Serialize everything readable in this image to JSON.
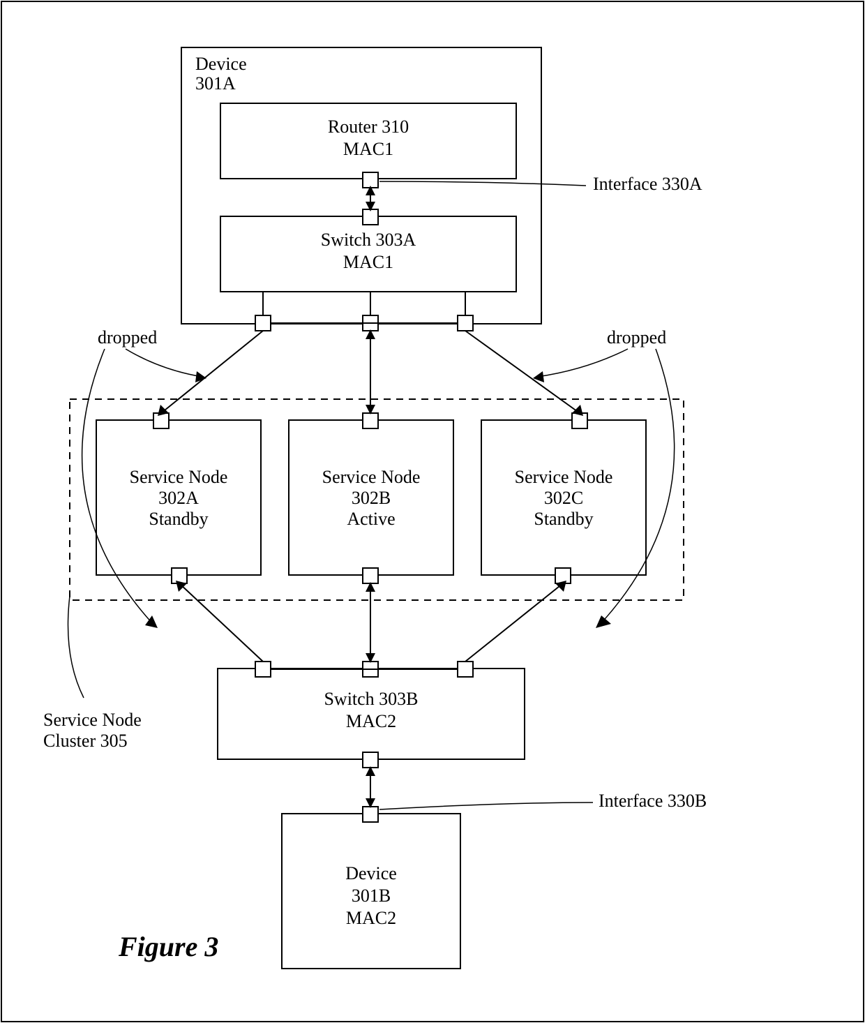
{
  "figure_label": "Figure 3",
  "device_a": {
    "title": "Device",
    "id": "301A"
  },
  "router": {
    "title": "Router 310",
    "mac": "MAC1"
  },
  "switch_a": {
    "title": "Switch 303A",
    "mac": "MAC1"
  },
  "switch_b": {
    "title": "Switch 303B",
    "mac": "MAC2"
  },
  "device_b": {
    "title": "Device",
    "id": "301B",
    "mac": "MAC2"
  },
  "node_a": {
    "title": "Service Node",
    "id": "302A",
    "state": "Standby"
  },
  "node_b": {
    "title": "Service Node",
    "id": "302B",
    "state": "Active"
  },
  "node_c": {
    "title": "Service Node",
    "id": "302C",
    "state": "Standby"
  },
  "cluster": {
    "l1": "Service Node",
    "l2": "Cluster 305"
  },
  "labels": {
    "interface_a": "Interface 330A",
    "interface_b": "Interface 330B",
    "dropped_left": "dropped",
    "dropped_right": "dropped"
  }
}
